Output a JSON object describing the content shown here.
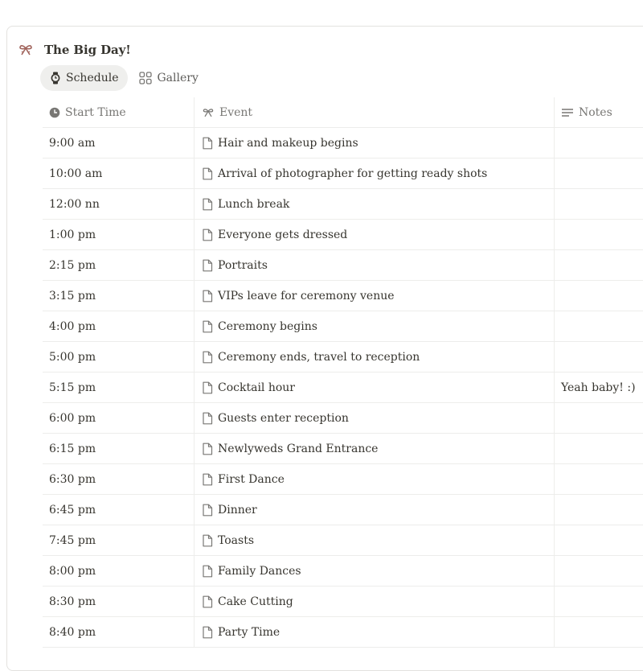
{
  "database": {
    "title": "The Big Day!",
    "icon": "bow-icon"
  },
  "views": [
    {
      "label": "Schedule",
      "icon": "watch-icon",
      "active": true
    },
    {
      "label": "Gallery",
      "icon": "grid-icon",
      "active": false
    }
  ],
  "columns": {
    "start_time": "Start Time",
    "event": "Event",
    "notes": "Notes"
  },
  "rows": [
    {
      "time": "9:00 am",
      "event": "Hair and makeup begins",
      "notes": ""
    },
    {
      "time": "10:00 am",
      "event": "Arrival of photographer for getting ready shots",
      "notes": ""
    },
    {
      "time": "12:00 nn",
      "event": "Lunch break",
      "notes": ""
    },
    {
      "time": "1:00 pm",
      "event": "Everyone gets dressed",
      "notes": ""
    },
    {
      "time": "2:15 pm",
      "event": "Portraits",
      "notes": ""
    },
    {
      "time": "3:15 pm",
      "event": "VIPs leave for ceremony venue",
      "notes": ""
    },
    {
      "time": "4:00 pm",
      "event": "Ceremony begins",
      "notes": ""
    },
    {
      "time": "5:00 pm",
      "event": "Ceremony ends, travel to reception",
      "notes": ""
    },
    {
      "time": "5:15 pm",
      "event": "Cocktail hour",
      "notes": "Yeah baby!  :)"
    },
    {
      "time": "6:00 pm",
      "event": "Guests enter reception",
      "notes": ""
    },
    {
      "time": "6:15 pm",
      "event": "Newlyweds Grand Entrance",
      "notes": ""
    },
    {
      "time": "6:30 pm",
      "event": "First Dance",
      "notes": ""
    },
    {
      "time": "6:45 pm",
      "event": "Dinner",
      "notes": ""
    },
    {
      "time": "7:45 pm",
      "event": "Toasts",
      "notes": ""
    },
    {
      "time": "8:00 pm",
      "event": "Family Dances",
      "notes": ""
    },
    {
      "time": "8:30 pm",
      "event": "Cake Cutting",
      "notes": ""
    },
    {
      "time": "8:40 pm",
      "event": "Party Time",
      "notes": ""
    }
  ],
  "colors": {
    "accent_bow": "#a0625a",
    "text": "#37352f",
    "muted": "#787774",
    "border": "#ededeb"
  }
}
